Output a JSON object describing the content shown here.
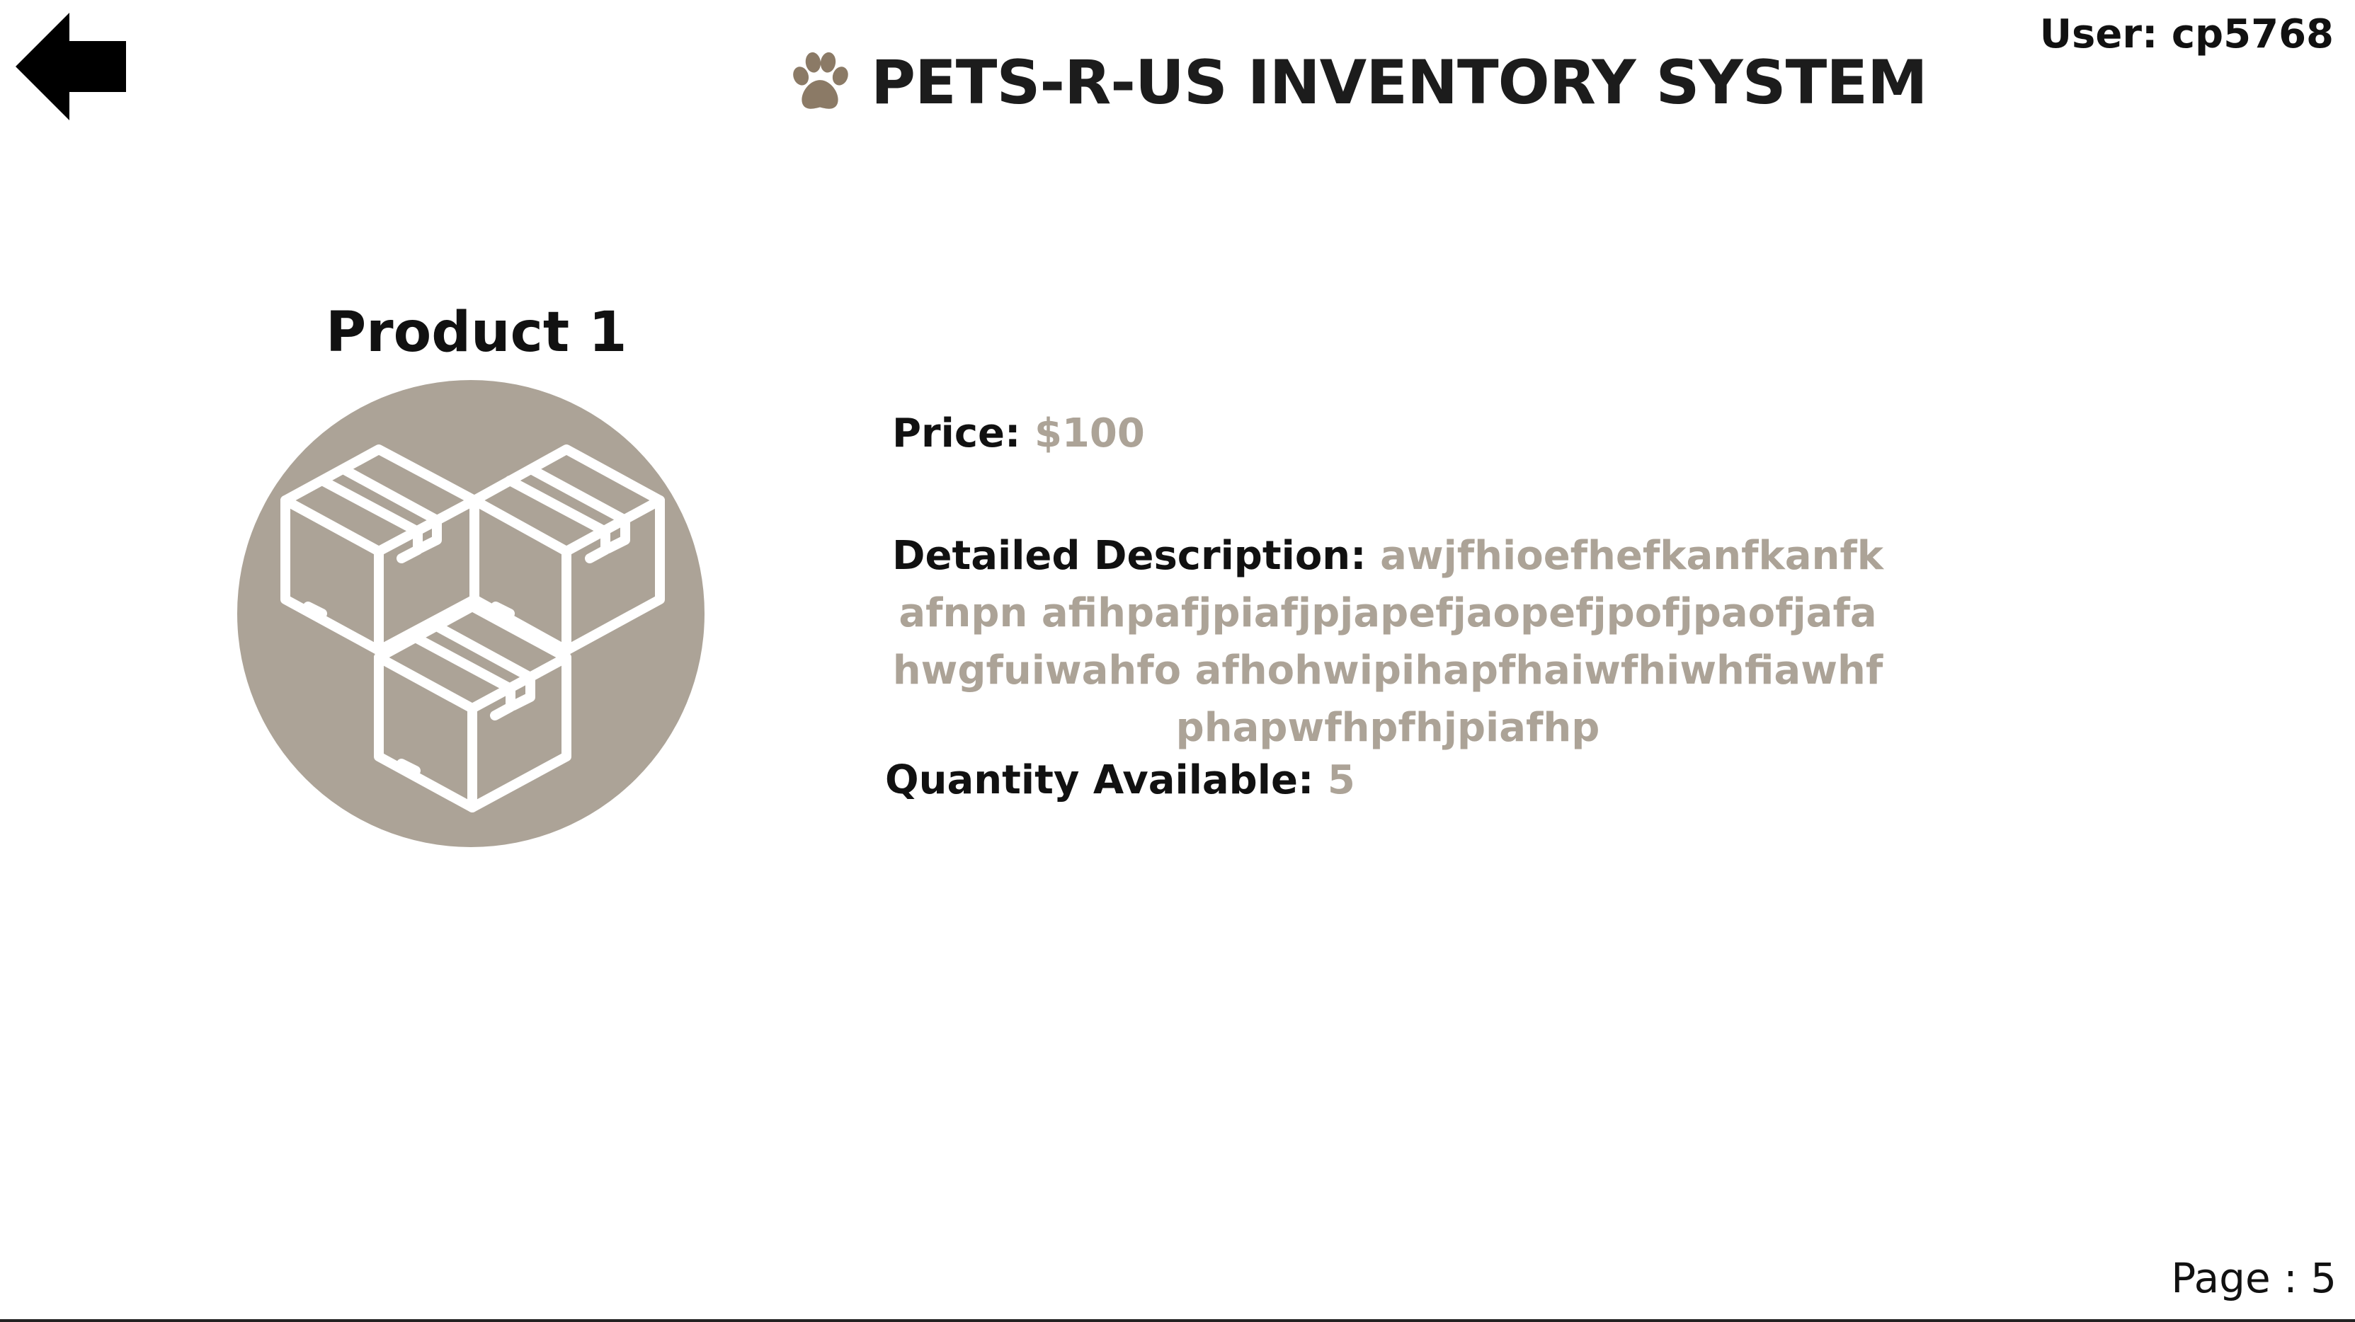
{
  "header": {
    "title": "PETS-R-US INVENTORY SYSTEM",
    "user_label": "User: cp5768",
    "back_icon": "arrow-left-icon",
    "logo_icon": "paw-icon"
  },
  "product": {
    "name": "Product 1",
    "image_icon": "stacked-boxes-icon",
    "price_label": "Price:",
    "price_value": "$100",
    "description_label": "Detailed Description:",
    "description_value": "awjfhioefhefkanfkanfkafnpn afihpafjpiafjpjapefjaopefjpofjpaofjafahwgfuiwahfo afhohwipihapfhaiwfhiwhfiawhfphapwfhpfhjpiafhp",
    "quantity_label": "Quantity Available:",
    "quantity_value": "5"
  },
  "footer": {
    "page_label": "Page : 5"
  },
  "colors": {
    "accent": "#aca397",
    "paw": "#8b7a66",
    "text": "#111111"
  }
}
